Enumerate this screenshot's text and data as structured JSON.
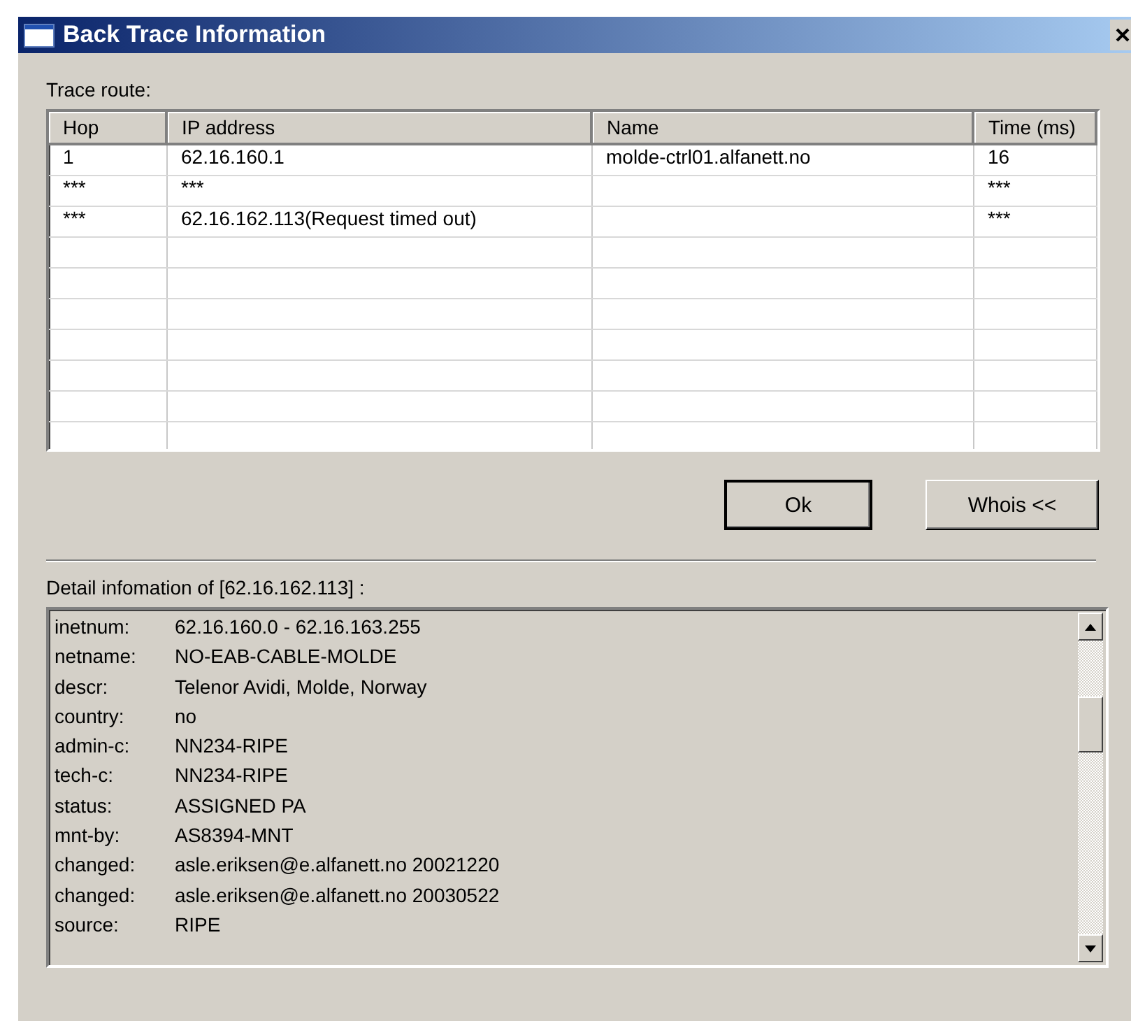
{
  "window": {
    "title": "Back Trace Information"
  },
  "trace_label": "Trace route:",
  "table": {
    "columns": [
      "Hop",
      "IP address",
      "Name",
      "Time (ms)"
    ],
    "rows": [
      [
        "1",
        "62.16.160.1",
        "molde-ctrl01.alfanett.no",
        "16"
      ],
      [
        "***",
        "***",
        "",
        "***"
      ],
      [
        "***",
        "62.16.162.113(Request timed out)",
        "",
        "***"
      ]
    ]
  },
  "buttons": [
    {
      "label": "Ok",
      "default": true
    },
    {
      "label": "Whois <<",
      "default": false
    }
  ],
  "detail_label": "Detail infomation of [62.16.162.113] :",
  "detail_lines": [
    {
      "key": "inetnum:",
      "value": "62.16.160.0 - 62.16.163.255"
    },
    {
      "key": "netname:",
      "value": "NO-EAB-CABLE-MOLDE"
    },
    {
      "key": "descr:",
      "value": "Telenor Avidi, Molde, Norway"
    },
    {
      "key": "country:",
      "value": "no"
    },
    {
      "key": "admin-c:",
      "value": "NN234-RIPE"
    },
    {
      "key": "tech-c:",
      "value": "NN234-RIPE"
    },
    {
      "key": "status:",
      "value": "ASSIGNED PA"
    },
    {
      "key": "mnt-by:",
      "value": "AS8394-MNT"
    },
    {
      "key": "changed:",
      "value": "asle.eriksen@e.alfanett.no 20021220"
    },
    {
      "key": "changed:",
      "value": "asle.eriksen@e.alfanett.no 20030522"
    },
    {
      "key": "source:",
      "value": "RIPE"
    }
  ]
}
